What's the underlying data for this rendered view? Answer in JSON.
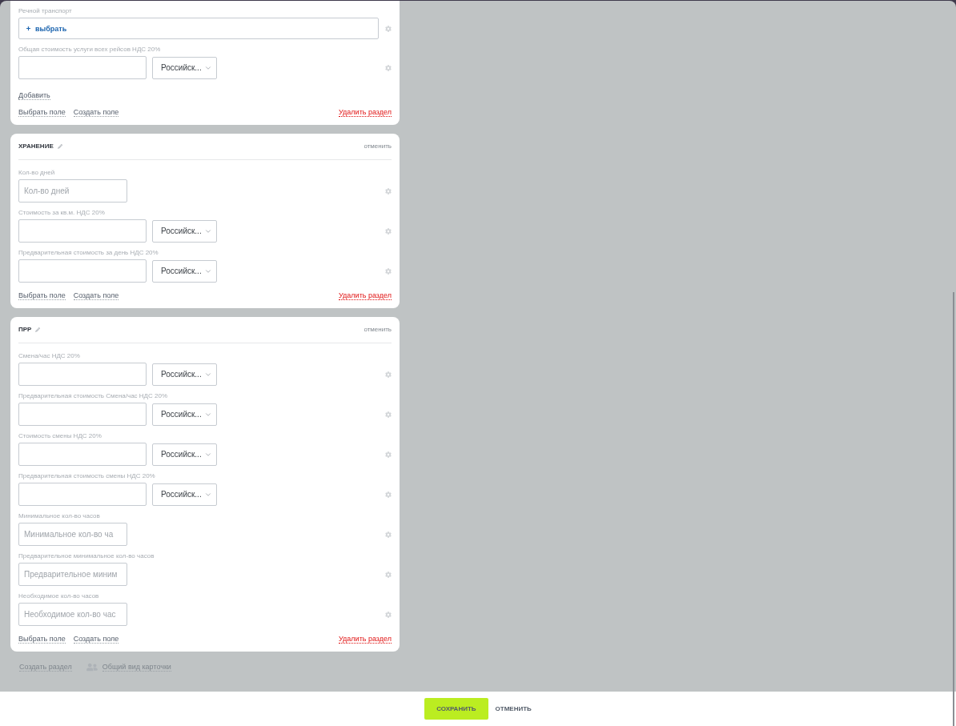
{
  "sections": [
    {
      "fields": [
        {
          "kind": "picker",
          "label": "Речной транспорт",
          "action": "выбрать"
        },
        {
          "kind": "money",
          "label": "Общая стоимость услуги всех рейсов НДС 20%",
          "currency": "Российск..."
        }
      ],
      "add_link": "Добавить",
      "links": [
        "Выбрать поле",
        "Создать поле"
      ],
      "delete_link": "Удалить раздел"
    },
    {
      "title": "ХРАНЕНИЕ",
      "cancel": "отменить",
      "fields": [
        {
          "kind": "number",
          "label": "Кол-во дней",
          "placeholder": "Кол-во дней"
        },
        {
          "kind": "money",
          "label": "Стоимость за кв.м. НДС 20%",
          "currency": "Российск..."
        },
        {
          "kind": "money",
          "label": "Предварительная стоимость за день НДС 20%",
          "currency": "Российск..."
        }
      ],
      "links": [
        "Выбрать поле",
        "Создать поле"
      ],
      "delete_link": "Удалить раздел"
    },
    {
      "title": "ПРР",
      "cancel": "отменить",
      "fields": [
        {
          "kind": "money",
          "label": "Смена/час НДС 20%",
          "currency": "Российск..."
        },
        {
          "kind": "money",
          "label": "Предварительная стоимость Смена/час НДС 20%",
          "currency": "Российск..."
        },
        {
          "kind": "money",
          "label": "Стоимость смены НДС 20%",
          "currency": "Российск..."
        },
        {
          "kind": "money",
          "label": "Предварительная стоимость смены НДС 20%",
          "currency": "Российск..."
        },
        {
          "kind": "number",
          "label": "Минимальное кол-во часов",
          "placeholder": "Минимальное кол-во ча"
        },
        {
          "kind": "number",
          "label": "Предварительное минимальное кол-во часов",
          "placeholder": "Предварительное миним"
        },
        {
          "kind": "number",
          "label": "Необходимое кол-во часов",
          "placeholder": "Необходимое кол-во час"
        }
      ],
      "links": [
        "Выбрать поле",
        "Создать поле"
      ],
      "delete_link": "Удалить раздел"
    }
  ],
  "page_links": {
    "create_section": "Создать раздел",
    "card_view": "Общий вид карточки"
  },
  "footer": {
    "save": "СОХРАНИТЬ",
    "cancel": "ОТМЕНИТЬ"
  }
}
